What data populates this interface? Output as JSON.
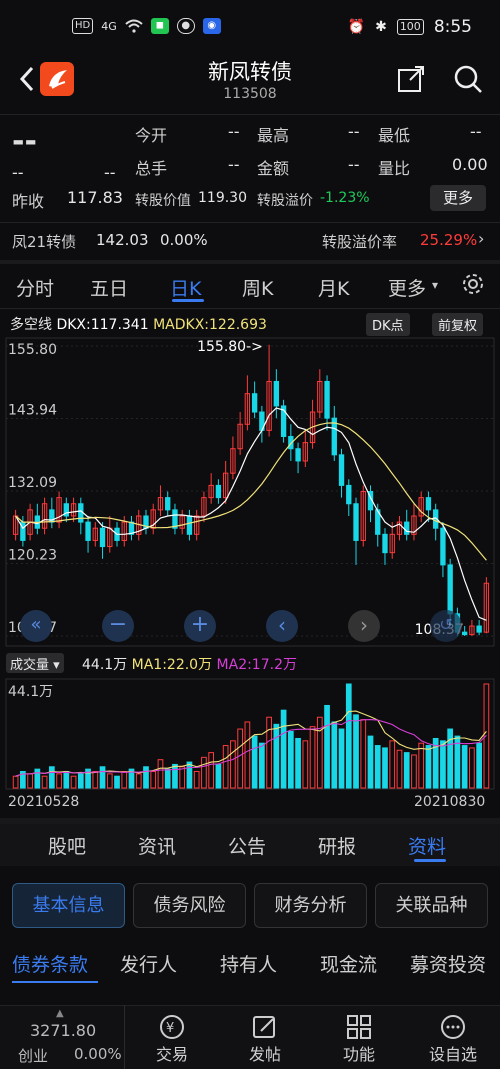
{
  "status": {
    "time": "8:55",
    "battery": "100",
    "net": "4G",
    "hd": "HD"
  },
  "header": {
    "title": "新凤转债",
    "code": "113508"
  },
  "quote": {
    "price": "--",
    "change": "--",
    "change_pct": "--",
    "open_label": "今开",
    "open": "--",
    "high_label": "最高",
    "high": "--",
    "low_label": "最低",
    "low": "--",
    "hand_label": "总手",
    "hand": "--",
    "amount_label": "金额",
    "amount": "--",
    "ratio_label": "量比",
    "ratio": "0.00",
    "prev_label": "昨收",
    "prev": "117.83",
    "conv_value_label": "转股价值",
    "conv_value": "119.30",
    "premium_label": "转股溢价",
    "premium": "-1.23%",
    "more": "更多",
    "stock_name": "凤21转债",
    "stock_price": "142.03",
    "stock_pct": "0.00%",
    "stock_premium_label": "转股溢价率",
    "stock_premium": "25.29%"
  },
  "tabs": [
    "分时",
    "五日",
    "日K",
    "周K",
    "月K",
    "更多"
  ],
  "chart": {
    "indicator": "多空线",
    "dkx": "DKX:117.341",
    "madkx": "MADKX:122.693",
    "dk_btn": "DK点",
    "adj_btn": "前复权",
    "y_labels": [
      "155.80",
      "143.94",
      "132.09",
      "120.23",
      "108.37"
    ],
    "max_mark": "155.80->",
    "min_mark": "108.37",
    "vol_label": "成交量",
    "vol_val": "44.1万",
    "ma1": "MA1:22.0万",
    "ma2": "MA2:17.2万",
    "vol_top": "44.1万",
    "date_start": "20210528",
    "date_end": "20210830",
    "colors": {
      "up": "#ff3b3b",
      "down": "#19d7e6",
      "dkx": "#ffffff",
      "madkx": "#f1e27a",
      "ma2": "#d63fd6"
    }
  },
  "chart_data": {
    "type": "candlestick",
    "ylim": [
      108.37,
      155.8
    ],
    "candles": [
      [
        125,
        128,
        124,
        129
      ],
      [
        127,
        124,
        123,
        128
      ],
      [
        125,
        129,
        124,
        130
      ],
      [
        128,
        126,
        125,
        130
      ],
      [
        126,
        130,
        125,
        131
      ],
      [
        129,
        127,
        126,
        131
      ],
      [
        127,
        131,
        126,
        132
      ],
      [
        130,
        128,
        127,
        131
      ],
      [
        128,
        130,
        127,
        131
      ],
      [
        130,
        127,
        125,
        131
      ],
      [
        127,
        124,
        122,
        128
      ],
      [
        124,
        126,
        123,
        127
      ],
      [
        126,
        123,
        121,
        127
      ],
      [
        123,
        126,
        122,
        128
      ],
      [
        126,
        124,
        123,
        127
      ],
      [
        124,
        127,
        123,
        128
      ],
      [
        127,
        125,
        124,
        128
      ],
      [
        125,
        128,
        124,
        129
      ],
      [
        128,
        126,
        125,
        129
      ],
      [
        126,
        129,
        125,
        130
      ],
      [
        129,
        131,
        128,
        133
      ],
      [
        131,
        129,
        128,
        132
      ],
      [
        129,
        126,
        125,
        130
      ],
      [
        126,
        128,
        125,
        129
      ],
      [
        128,
        125,
        124,
        129
      ],
      [
        125,
        128,
        124,
        129
      ],
      [
        128,
        131,
        127,
        132
      ],
      [
        131,
        133,
        130,
        135
      ],
      [
        133,
        131,
        130,
        134
      ],
      [
        131,
        135,
        130,
        137
      ],
      [
        135,
        139,
        134,
        141
      ],
      [
        139,
        143,
        138,
        145
      ],
      [
        143,
        148,
        142,
        151
      ],
      [
        148,
        145,
        144,
        150
      ],
      [
        145,
        142,
        140,
        146
      ],
      [
        142,
        150,
        141,
        156
      ],
      [
        150,
        146,
        144,
        152
      ],
      [
        146,
        141,
        140,
        147
      ],
      [
        141,
        139,
        137,
        143
      ],
      [
        139,
        137,
        135,
        140
      ],
      [
        137,
        140,
        136,
        142
      ],
      [
        140,
        145,
        139,
        147
      ],
      [
        145,
        150,
        144,
        152
      ],
      [
        150,
        144,
        142,
        151
      ],
      [
        144,
        138,
        137,
        146
      ],
      [
        138,
        133,
        131,
        139
      ],
      [
        133,
        130,
        128,
        134
      ],
      [
        130,
        124,
        120,
        131
      ],
      [
        124,
        132,
        123,
        133
      ],
      [
        132,
        129,
        127,
        133
      ],
      [
        129,
        125,
        123,
        130
      ],
      [
        125,
        122,
        120,
        126
      ],
      [
        122,
        125,
        121,
        127
      ],
      [
        125,
        127,
        124,
        128
      ],
      [
        127,
        125,
        124,
        129
      ],
      [
        125,
        128,
        124,
        130
      ],
      [
        128,
        131,
        127,
        132
      ],
      [
        131,
        129,
        127,
        132
      ],
      [
        129,
        126,
        124,
        130
      ],
      [
        126,
        120,
        118,
        127
      ],
      [
        120,
        112,
        110,
        121
      ],
      [
        112,
        109,
        108.4,
        113
      ],
      [
        109,
        108.6,
        108.37,
        110
      ],
      [
        108.6,
        110,
        108.4,
        111
      ],
      [
        110,
        109,
        108.5,
        111
      ],
      [
        109,
        117,
        108.8,
        118
      ]
    ],
    "volume": [
      5,
      7,
      6,
      8,
      5,
      9,
      6,
      7,
      5,
      6,
      8,
      7,
      9,
      6,
      5,
      7,
      8,
      6,
      9,
      7,
      12,
      8,
      10,
      9,
      11,
      7,
      13,
      15,
      10,
      18,
      20,
      25,
      28,
      22,
      19,
      30,
      27,
      33,
      24,
      21,
      20,
      26,
      30,
      35,
      28,
      25,
      44.1,
      31,
      29,
      22,
      18,
      17,
      20,
      16,
      15,
      14,
      19,
      18,
      21,
      20,
      25,
      22,
      18,
      17,
      19,
      44.1
    ],
    "series": [
      {
        "name": "DKX"
      },
      {
        "name": "MADKX"
      }
    ]
  },
  "bottom_tabs": [
    "股吧",
    "资讯",
    "公告",
    "研报",
    "资料"
  ],
  "segments": [
    "基本信息",
    "债务风险",
    "财务分析",
    "关联品种"
  ],
  "sub_tabs": [
    "债券条款",
    "发行人",
    "持有人",
    "现金流",
    "募资投资"
  ],
  "nav": {
    "index_val": "3271.80",
    "index_name": "创业",
    "index_pct": "0.00%",
    "items": [
      "交易",
      "发帖",
      "功能",
      "设自选"
    ]
  }
}
